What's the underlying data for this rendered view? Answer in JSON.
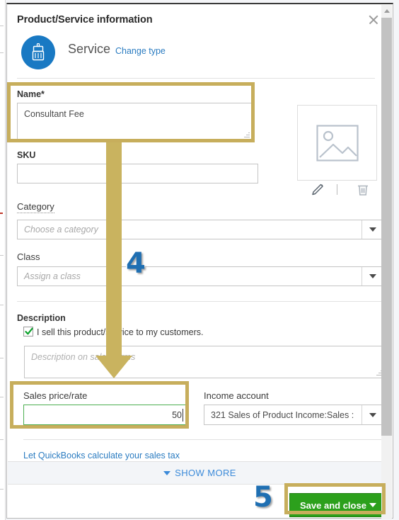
{
  "modal": {
    "title": "Product/Service information",
    "close_icon": "close-icon",
    "type": {
      "icon": "paintbrush-icon",
      "label": "Service",
      "change_link": "Change type"
    },
    "name": {
      "label": "Name*",
      "value": "Consultant Fee"
    },
    "sku": {
      "label": "SKU",
      "value": ""
    },
    "category": {
      "label": "Category",
      "placeholder": "Choose a category",
      "value": ""
    },
    "class": {
      "label": "Class",
      "placeholder": "Assign a class",
      "value": ""
    },
    "description": {
      "label": "Description",
      "checkbox_label": "I sell this product/service to my customers.",
      "checkbox_checked": true,
      "placeholder": "Description on sales forms",
      "value": ""
    },
    "sales_price": {
      "label": "Sales price/rate",
      "value": "50"
    },
    "income_account": {
      "label": "Income account",
      "value": "321 Sales of Product Income:Sales :"
    },
    "tax_link": "Let QuickBooks calculate your sales tax",
    "show_more": "SHOW MORE",
    "image": {
      "placeholder_icon": "image-placeholder-icon",
      "edit_icon": "pencil-icon",
      "delete_icon": "trash-icon"
    },
    "footer": {
      "save_label": "Save and close",
      "save_caret_icon": "chevron-down-icon"
    }
  },
  "annotations": {
    "step_4": "4",
    "step_5": "5",
    "highlight_color": "#c7ae5c",
    "arrow_color": "#c9b35f",
    "step_color": "#1f6fb2"
  },
  "colors": {
    "accent_blue": "#2b7cc1",
    "save_green": "#2ca01c",
    "focus_green": "#4caf50"
  }
}
